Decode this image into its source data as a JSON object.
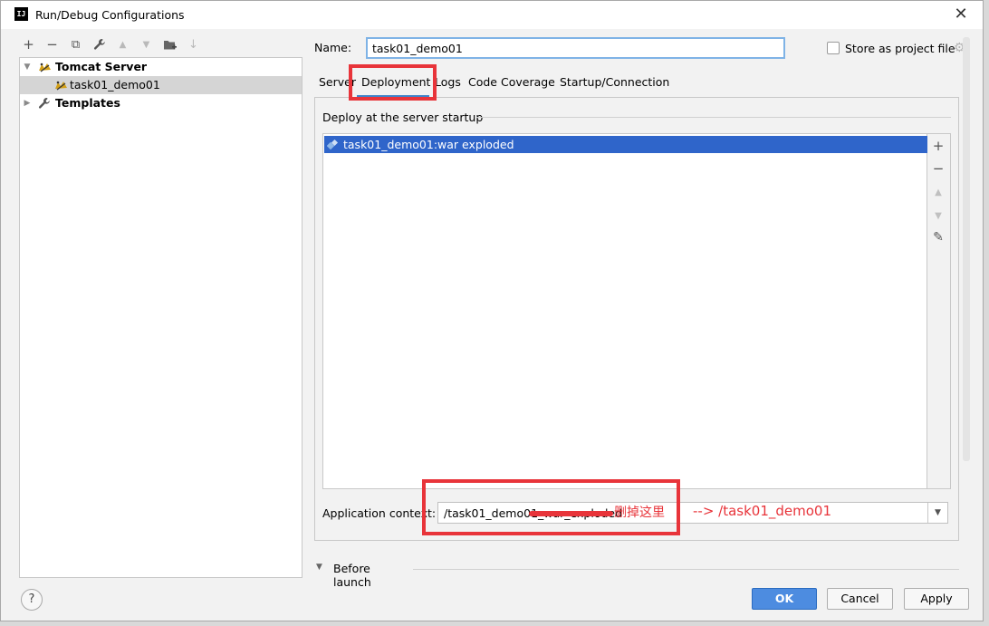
{
  "window": {
    "title": "Run/Debug Configurations",
    "app_icon": "IJ",
    "close": "✕"
  },
  "toolbar": {
    "add": "+",
    "remove": "−",
    "copy": "⧉",
    "edit": "✎",
    "up": "▲",
    "down": "▼",
    "folder": "▬",
    "sort": "↓"
  },
  "tree": {
    "items": [
      {
        "label": "Tomcat Server",
        "expanded": true
      },
      {
        "label": "task01_demo01",
        "selected": true
      },
      {
        "label": "Templates",
        "expanded": false
      }
    ]
  },
  "form": {
    "name_label": "Name:",
    "name_value": "task01_demo01",
    "store_label": "Store as project file",
    "store_checked": false
  },
  "tabs": [
    {
      "label": "Server"
    },
    {
      "label": "Deployment",
      "active": true
    },
    {
      "label": "Logs"
    },
    {
      "label": "Code Coverage"
    },
    {
      "label": "Startup/Connection"
    }
  ],
  "deployment": {
    "caption": "Deploy at the server startup",
    "items": [
      {
        "label": "task01_demo01:war exploded",
        "selected": true
      }
    ],
    "tools": {
      "add": "+",
      "remove": "−",
      "up": "▲",
      "down": "▼",
      "edit": "✎"
    },
    "app_context_label": "Application context:",
    "app_context_value": "/task01_demo01_war_exploded"
  },
  "before_launch": {
    "label": "Before launch"
  },
  "buttons": {
    "help": "?",
    "ok": "OK",
    "cancel": "Cancel",
    "apply": "Apply"
  },
  "annotations": {
    "delete_here": "删掉这里",
    "replacement": "--> /task01_demo01",
    "color": "#e8343a"
  }
}
